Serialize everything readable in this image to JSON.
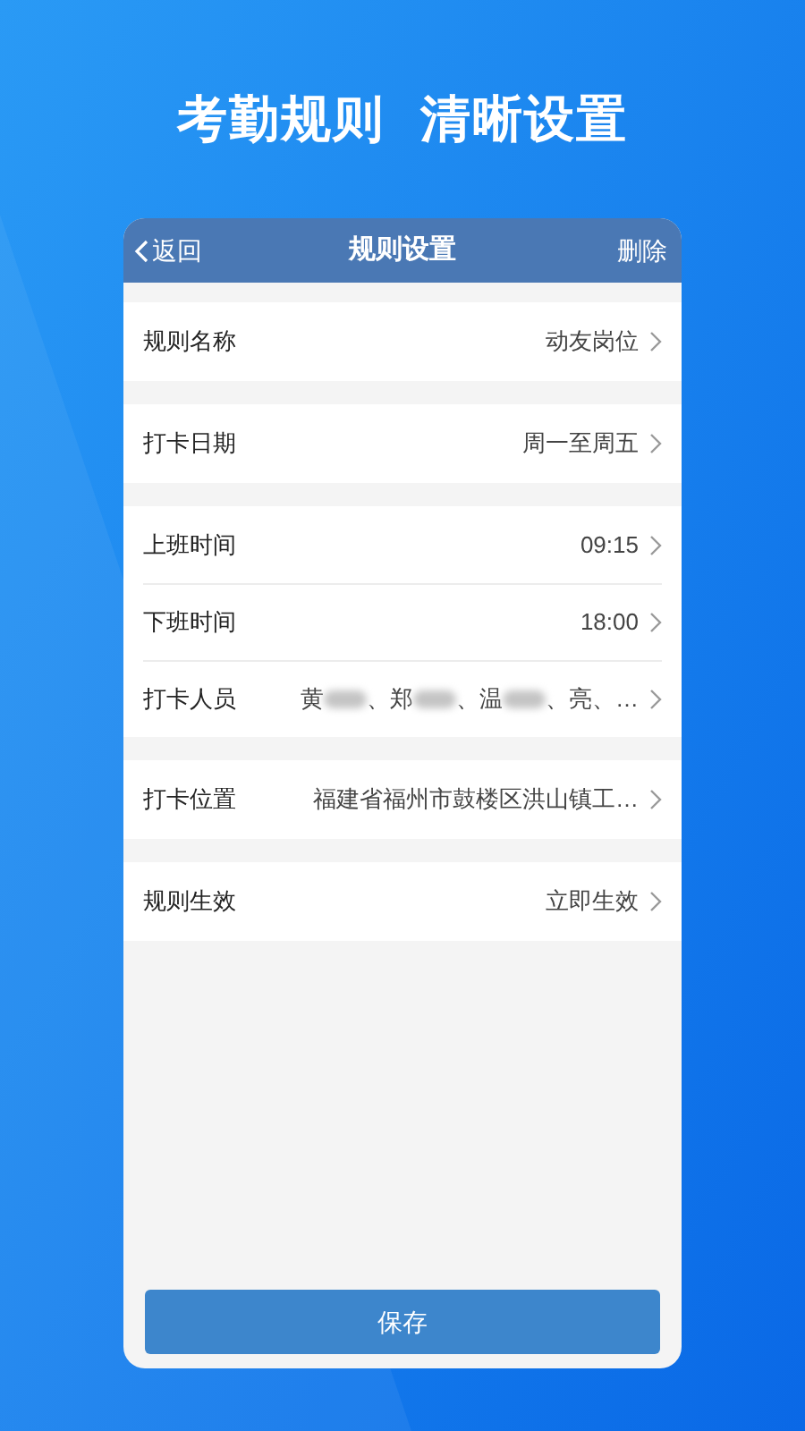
{
  "headline": [
    "考勤规则",
    "清晰设置"
  ],
  "nav": {
    "back": "返回",
    "title": "规则设置",
    "action": "删除"
  },
  "groups": [
    {
      "rows": [
        {
          "kind": "text",
          "label": "规则名称",
          "value": "动友岗位"
        }
      ]
    },
    {
      "rows": [
        {
          "kind": "text",
          "label": "打卡日期",
          "value": "周一至周五"
        }
      ]
    },
    {
      "rows": [
        {
          "kind": "text",
          "label": "上班时间",
          "value": "09:15"
        },
        {
          "kind": "text",
          "label": "下班时间",
          "value": "18:00"
        },
        {
          "kind": "people",
          "label": "打卡人员",
          "segments": [
            "黄",
            "、郑",
            "、温",
            "、亮、…"
          ]
        }
      ]
    },
    {
      "rows": [
        {
          "kind": "text",
          "label": "打卡位置",
          "value": "福建省福州市鼓楼区洪山镇工…"
        }
      ]
    },
    {
      "rows": [
        {
          "kind": "text",
          "label": "规则生效",
          "value": "立即生效"
        }
      ]
    }
  ],
  "save_button": "保存"
}
